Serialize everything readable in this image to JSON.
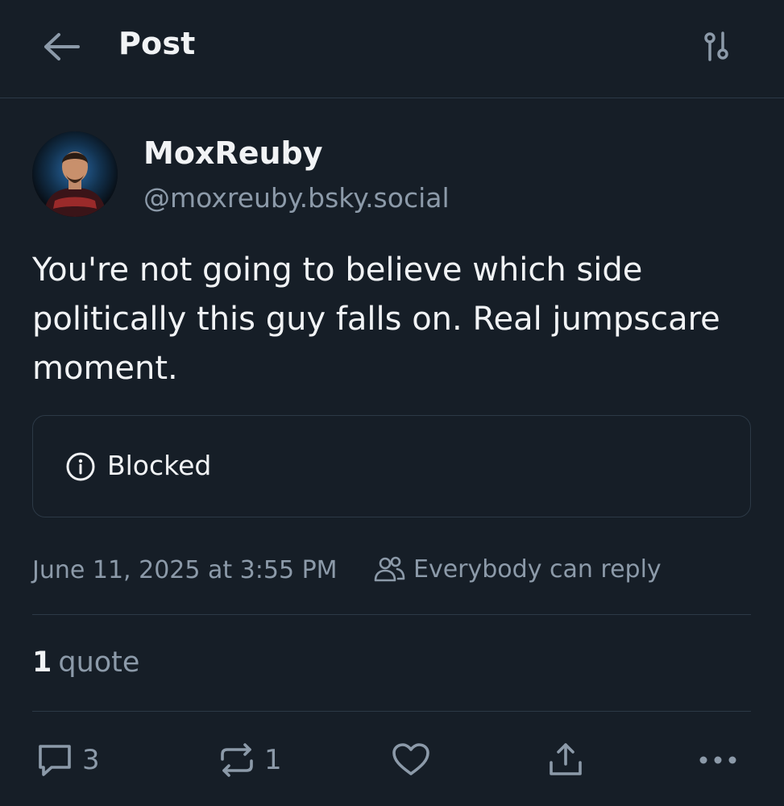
{
  "header": {
    "title": "Post",
    "back_icon": "arrow-left-icon",
    "settings_icon": "sliders-icon"
  },
  "author": {
    "display_name": "MoxReuby",
    "handle": "@moxreuby.bsky.social"
  },
  "post": {
    "text": "You're not going to believe which side politically this guy falls on. Real jumpscare moment.",
    "embed": {
      "icon": "info-icon",
      "label": "Blocked"
    },
    "timestamp": "June 11, 2025 at 3:55 PM",
    "reply_setting": "Everybody can reply"
  },
  "stats": {
    "quote_count": "1",
    "quote_label": "quote"
  },
  "actions": {
    "reply_count": "3",
    "repost_count": "1"
  },
  "colors": {
    "background": "#161e27",
    "text": "#f1f3f5",
    "muted": "#8c9aa9",
    "border": "#2c3946"
  }
}
